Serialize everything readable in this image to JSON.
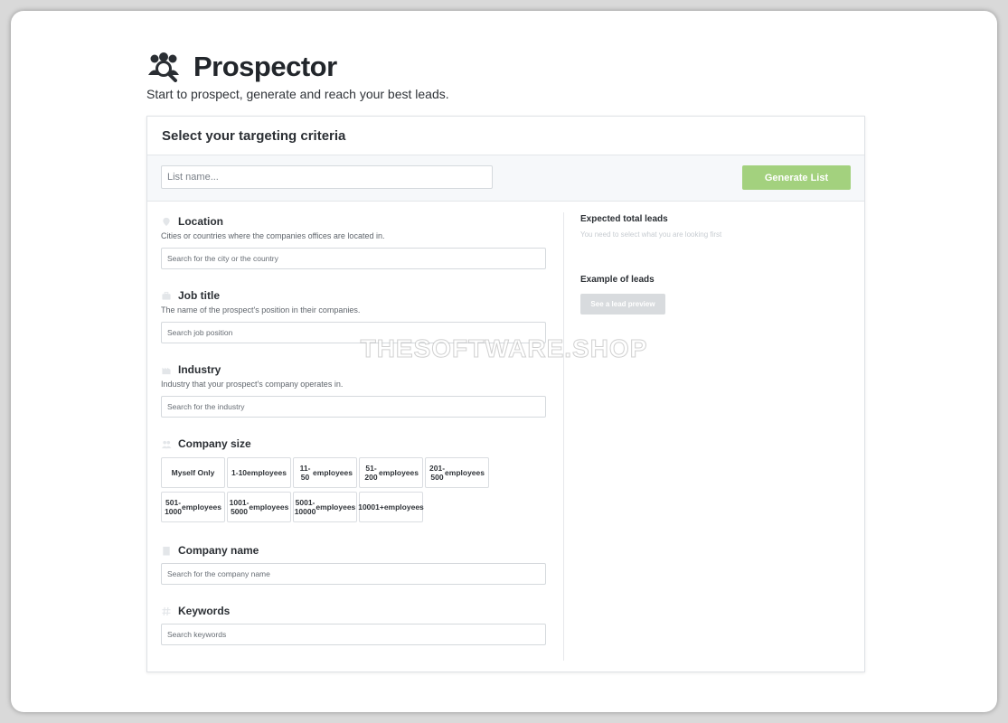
{
  "app": {
    "name": "Prospector",
    "tagline": "Start to prospect, generate and reach your best leads."
  },
  "card": {
    "title": "Select your targeting criteria"
  },
  "toolbar": {
    "list_name_placeholder": "List name...",
    "generate_label": "Generate List"
  },
  "criteria": {
    "location": {
      "title": "Location",
      "description": "Cities or countries where the companies offices are located in.",
      "placeholder": "Search for the city or the country"
    },
    "job_title": {
      "title": "Job title",
      "description": "The name of the prospect's position in their companies.",
      "placeholder": "Search job position"
    },
    "industry": {
      "title": "Industry",
      "description": "Industry that your prospect's company operates in.",
      "placeholder": "Search for the industry"
    },
    "company_size": {
      "title": "Company size",
      "options": [
        [
          "Myself Only"
        ],
        [
          "1-10",
          "employees"
        ],
        [
          "11-50",
          "employees"
        ],
        [
          "51-200",
          "employees"
        ],
        [
          "201-500",
          "employees"
        ],
        [
          "501-1000",
          "employees"
        ],
        [
          "1001-5000",
          "employees"
        ],
        [
          "5001-10000",
          "employees"
        ],
        [
          "10001+",
          "employees"
        ]
      ]
    },
    "company_name": {
      "title": "Company name",
      "placeholder": "Search for the company name"
    },
    "keywords": {
      "title": "Keywords",
      "placeholder": "Search keywords"
    }
  },
  "summary": {
    "expected_title": "Expected total leads",
    "expected_hint": "You need to select what you are looking first",
    "example_title": "Example of leads",
    "preview_label": "See a lead preview"
  },
  "watermark": "THESOFTWARE.SHOP",
  "colors": {
    "accent": "#a3d17e",
    "disabled": "#d8dbde",
    "border": "#d5d9dd"
  }
}
